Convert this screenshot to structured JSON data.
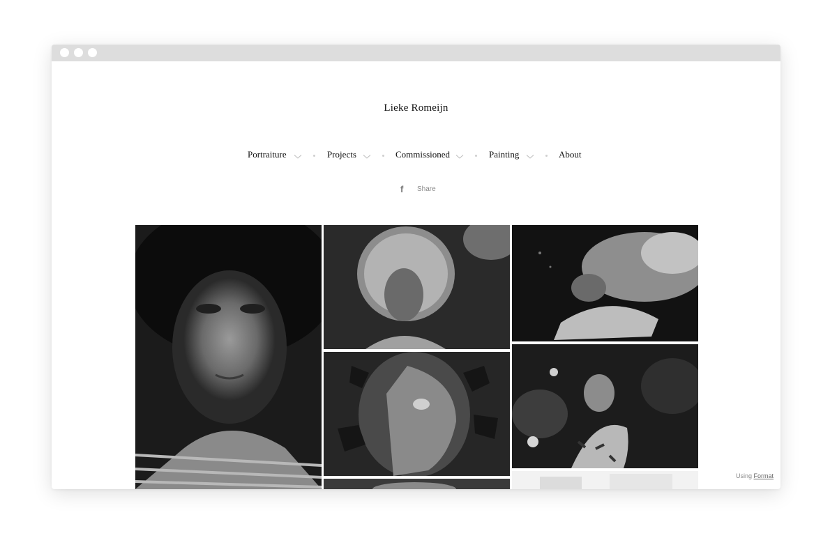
{
  "site": {
    "title": "Lieke Romeijn"
  },
  "nav": {
    "items": [
      {
        "label": "Portraiture",
        "has_dropdown": true
      },
      {
        "label": "Projects",
        "has_dropdown": true
      },
      {
        "label": "Commissioned",
        "has_dropdown": true
      },
      {
        "label": "Painting",
        "has_dropdown": true
      },
      {
        "label": "About",
        "has_dropdown": false
      }
    ]
  },
  "share": {
    "icon": "facebook-icon",
    "label": "Share"
  },
  "gallery": {
    "photos": [
      {
        "id": "portrait-freckles",
        "tone": "dark"
      },
      {
        "id": "portrait-curly-hair",
        "tone": "dark"
      },
      {
        "id": "child-lying-fur",
        "tone": "dark"
      },
      {
        "id": "profile-leaves",
        "tone": "dark"
      },
      {
        "id": "girl-in-garden",
        "tone": "dark"
      },
      {
        "id": "partial-bottom-middle",
        "tone": "mid"
      },
      {
        "id": "partial-bottom-right",
        "tone": "light"
      }
    ]
  },
  "footer": {
    "using_label": "Using",
    "format_link": "Format"
  },
  "colors": {
    "titlebar": "#dddddd",
    "text": "#111111",
    "muted": "#888888"
  }
}
